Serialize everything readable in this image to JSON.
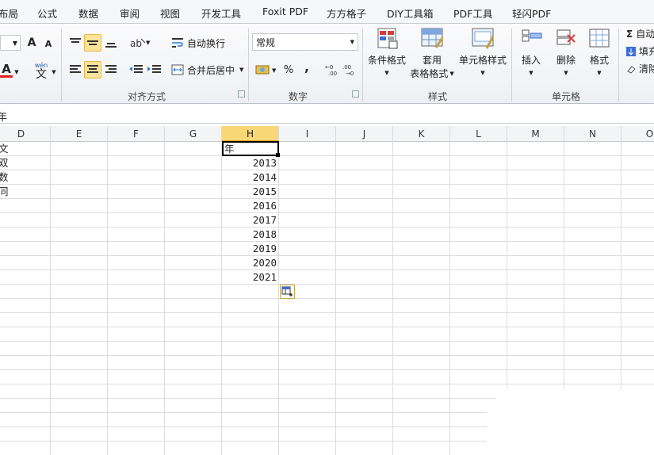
{
  "tabs": [
    "布局",
    "公式",
    "数据",
    "审阅",
    "视图",
    "开发工具",
    "Foxit PDF",
    "方方格子",
    "DIY工具箱",
    "PDF工具",
    "轻闪PDF"
  ],
  "ribbon": {
    "groups": {
      "alignment": "对齐方式",
      "number": "数字",
      "styles": "样式",
      "cells": "单元格"
    },
    "font_grow": "A",
    "font_shrink": "A",
    "wen_label": "wén",
    "wen_char": "文",
    "wrap_text": "自动换行",
    "merge_center": "合并后居中",
    "number_format": "常规",
    "percent": "%",
    "comma": ",",
    "conditional_format": "条件格式",
    "table_format_1": "套用",
    "table_format_2": "表格格式",
    "cell_styles": "单元格样式",
    "insert": "插入",
    "delete": "删除",
    "format": "格式",
    "autosum": "自动",
    "fill": "填充",
    "clear": "清除",
    "sigma": "Σ"
  },
  "formula_bar": {
    "content": "年"
  },
  "columns": [
    "D",
    "E",
    "F",
    "G",
    "H",
    "I",
    "J",
    "K",
    "L",
    "M",
    "N",
    "O"
  ],
  "selected_column": "H",
  "column_d_values": [
    "文",
    "双",
    "数",
    "同"
  ],
  "column_h_header": "年",
  "column_h_values": [
    "2013",
    "2014",
    "2015",
    "2016",
    "2017",
    "2018",
    "2019",
    "2020",
    "2021"
  ],
  "colors": {
    "selection_border": "#000000",
    "column_highlight": "#f9d776",
    "accent": "#2b7bd1"
  }
}
